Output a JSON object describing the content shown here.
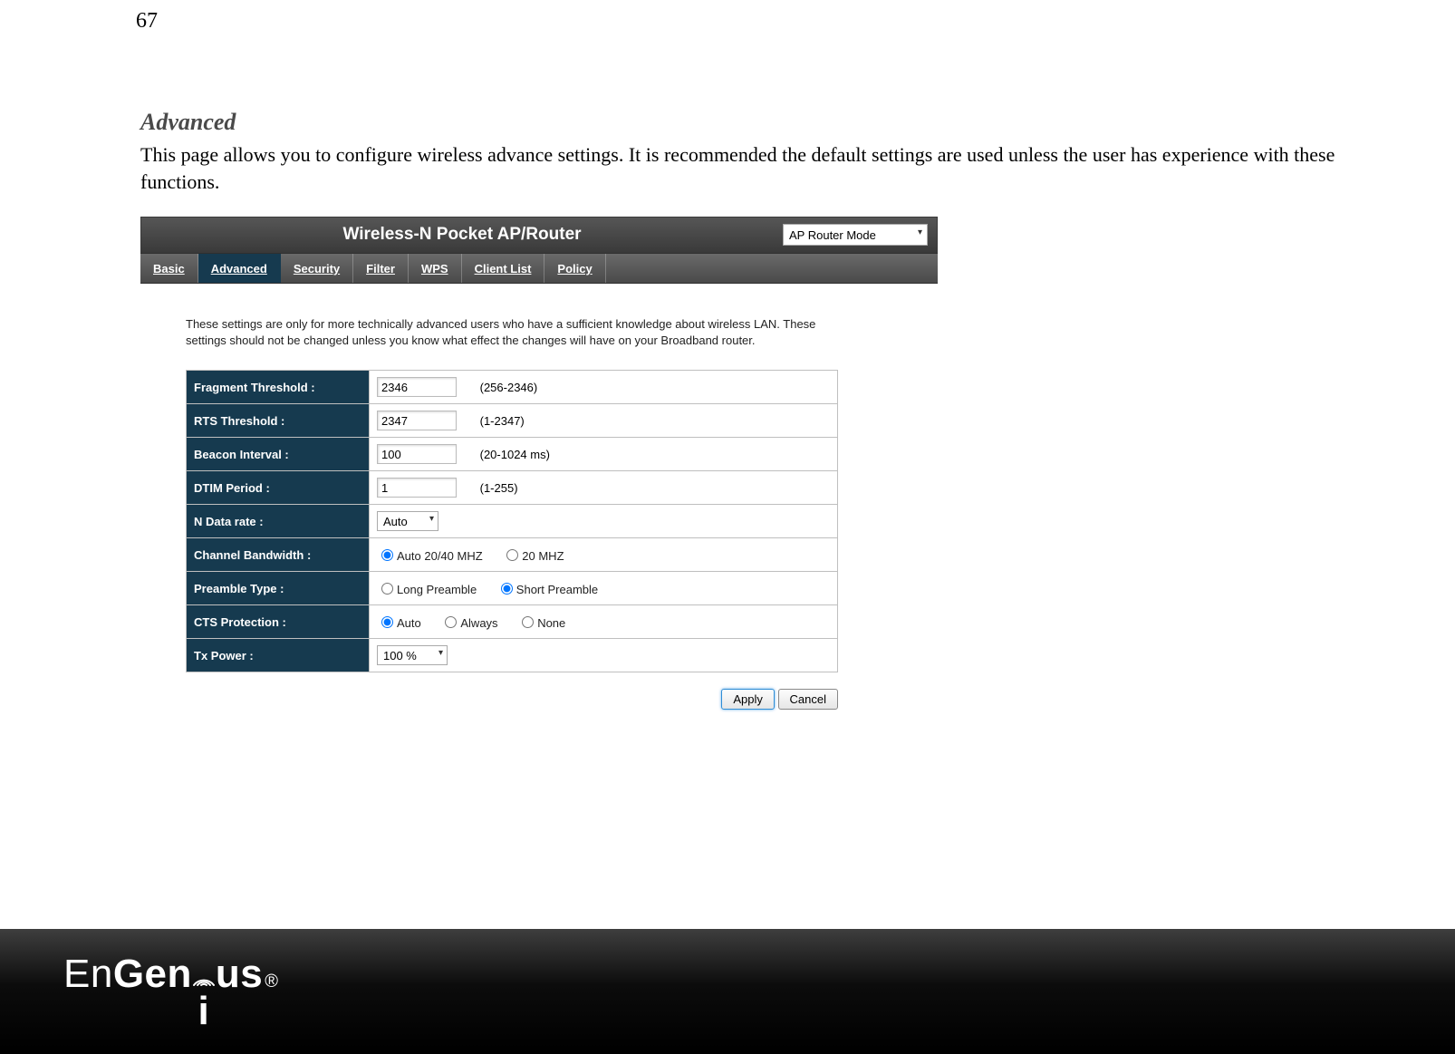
{
  "page_number": "67",
  "heading": "Advanced",
  "paragraph": "This page allows you to configure wireless advance settings. It is recommended the default settings are used unless the user has experience with these functions.",
  "titlebar": {
    "title": "Wireless-N Pocket AP/Router",
    "mode_selected": "AP Router Mode"
  },
  "tabs": [
    "Basic",
    "Advanced",
    "Security",
    "Filter",
    "WPS",
    "Client List",
    "Policy"
  ],
  "active_tab_index": 1,
  "panel_intro": "These settings are only for more technically advanced users who have a sufficient knowledge about wireless LAN. These settings should not be changed unless you know what effect the changes will have on your Broadband router.",
  "rows": {
    "fragment": {
      "label": "Fragment Threshold :",
      "value": "2346",
      "hint": "(256-2346)"
    },
    "rts": {
      "label": "RTS Threshold :",
      "value": "2347",
      "hint": "(1-2347)"
    },
    "beacon": {
      "label": "Beacon Interval :",
      "value": "100",
      "hint": "(20-1024 ms)"
    },
    "dtim": {
      "label": "DTIM Period :",
      "value": "1",
      "hint": "(1-255)"
    },
    "ndata": {
      "label": "N Data rate :",
      "selected": "Auto"
    },
    "chanbw": {
      "label": "Channel Bandwidth :",
      "opts": [
        "Auto 20/40 MHZ",
        "20 MHZ"
      ],
      "selected_index": 0
    },
    "preamble": {
      "label": "Preamble Type :",
      "opts": [
        "Long Preamble",
        "Short Preamble"
      ],
      "selected_index": 1
    },
    "cts": {
      "label": "CTS Protection :",
      "opts": [
        "Auto",
        "Always",
        "None"
      ],
      "selected_index": 0
    },
    "txpower": {
      "label": "Tx Power :",
      "selected": "100 %"
    }
  },
  "buttons": {
    "apply": "Apply",
    "cancel": "Cancel"
  },
  "logo": {
    "en": "En",
    "gen": "Gen",
    "i": "i",
    "us": "us",
    "reg": "®"
  }
}
